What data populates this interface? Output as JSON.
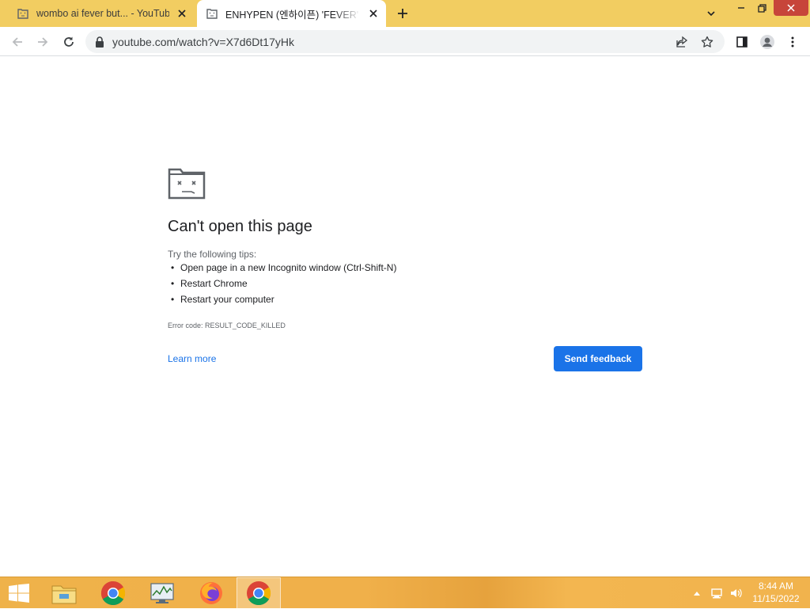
{
  "browser": {
    "tabs": [
      {
        "title": "wombo ai fever but... - YouTube",
        "active": false
      },
      {
        "title": "ENHYPEN (엔하이픈) 'FEVER' Offi",
        "active": true
      }
    ],
    "url": "youtube.com/watch?v=X7d6Dt17yHk",
    "colors": {
      "frame": "#f2cd61",
      "omnibox": "#f1f3f4",
      "accent": "#1a73e8",
      "close": "#c7453a"
    }
  },
  "error_page": {
    "heading": "Can't open this page",
    "tips_intro": "Try the following tips:",
    "tips": [
      "Open page in a new Incognito window (Ctrl-Shift-N)",
      "Restart Chrome",
      "Restart your computer"
    ],
    "error_code": "Error code: RESULT_CODE_KILLED",
    "learn_more": "Learn more",
    "send_feedback": "Send feedback"
  },
  "taskbar": {
    "apps": [
      "file-explorer-icon",
      "chrome-icon",
      "resource-monitor-icon",
      "firefox-icon",
      "chrome-icon"
    ],
    "active_app": "chrome-icon",
    "time": "8:44 AM",
    "date": "11/15/2022"
  }
}
